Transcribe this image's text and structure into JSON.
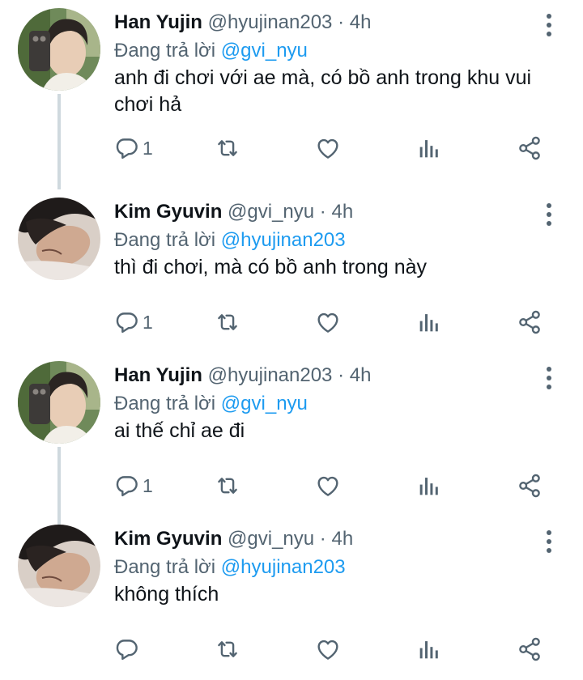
{
  "accent_color": "#1d9bf0",
  "muted_color": "#536471",
  "tweets": [
    {
      "name": "Han Yujin",
      "handle": "@hyujinan203",
      "dot": "·",
      "time": "4h",
      "replying_prefix": "Đang trả lời",
      "replying_to": "@gvi_nyu",
      "text": "anh đi chơi với ae mà, có bồ anh trong khu vui chơi hả",
      "reply_count": "1",
      "avatar_icon": "avatar-han-yujin"
    },
    {
      "name": "Kim Gyuvin",
      "handle": "@gvi_nyu",
      "dot": "·",
      "time": "4h",
      "replying_prefix": "Đang trả lời",
      "replying_to": "@hyujinan203",
      "text": "thì đi chơi, mà có bồ anh trong này",
      "reply_count": "1",
      "avatar_icon": "avatar-kim-gyuvin"
    },
    {
      "name": "Han Yujin",
      "handle": "@hyujinan203",
      "dot": "·",
      "time": "4h",
      "replying_prefix": "Đang trả lời",
      "replying_to": "@gvi_nyu",
      "text": "ai thế chỉ ae đi",
      "reply_count": "1",
      "avatar_icon": "avatar-han-yujin"
    },
    {
      "name": "Kim Gyuvin",
      "handle": "@gvi_nyu",
      "dot": "·",
      "time": "4h",
      "replying_prefix": "Đang trả lời",
      "replying_to": "@hyujinan203",
      "text": "không thích",
      "reply_count": "",
      "avatar_icon": "avatar-kim-gyuvin"
    }
  ]
}
